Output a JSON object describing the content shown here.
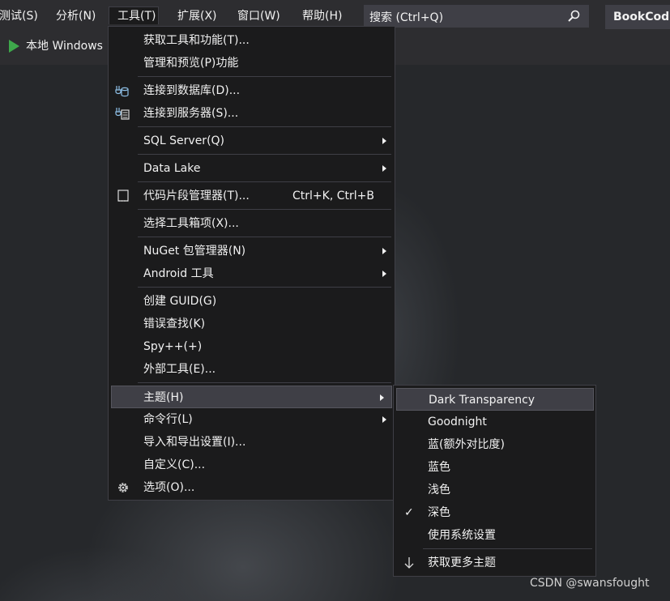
{
  "menubar": {
    "items": [
      {
        "label": "测试(S)"
      },
      {
        "label": "分析(N)"
      },
      {
        "label": "工具(T)"
      },
      {
        "label": "扩展(X)"
      },
      {
        "label": "窗口(W)"
      },
      {
        "label": "帮助(H)"
      }
    ],
    "search_placeholder": "搜索 (Ctrl+Q)",
    "solution_name": "BookCod"
  },
  "toolbar": {
    "run_label": "本地 Windows"
  },
  "tools_menu": {
    "items": [
      {
        "label": "获取工具和功能(T)..."
      },
      {
        "label": "管理和预览(P)功能"
      },
      {
        "label": "连接到数据库(D)...",
        "icon": "database-connect-icon"
      },
      {
        "label": "连接到服务器(S)...",
        "icon": "server-connect-icon"
      },
      {
        "label": "SQL Server(Q)"
      },
      {
        "label": "Data Lake"
      },
      {
        "label": "代码片段管理器(T)...",
        "shortcut": "Ctrl+K, Ctrl+B",
        "icon": "snippet-icon"
      },
      {
        "label": "选择工具箱项(X)..."
      },
      {
        "label": "NuGet 包管理器(N)"
      },
      {
        "label": "Android 工具"
      },
      {
        "label": "创建 GUID(G)"
      },
      {
        "label": "错误查找(K)"
      },
      {
        "label": "Spy++(+)"
      },
      {
        "label": "外部工具(E)..."
      },
      {
        "label": "主题(H)"
      },
      {
        "label": "命令行(L)"
      },
      {
        "label": "导入和导出设置(I)..."
      },
      {
        "label": "自定义(C)..."
      },
      {
        "label": "选项(O)...",
        "icon": "gear-icon"
      }
    ]
  },
  "theme_menu": {
    "items": [
      {
        "label": "Dark Transparency"
      },
      {
        "label": "Goodnight"
      },
      {
        "label": "蓝(额外对比度)"
      },
      {
        "label": "蓝色"
      },
      {
        "label": "浅色"
      },
      {
        "label": "深色",
        "checked": true
      },
      {
        "label": "使用系统设置"
      },
      {
        "label": "获取更多主题",
        "icon": "download-arrow-icon"
      }
    ],
    "check_mark": "✓"
  },
  "watermark": "CSDN @swansfought",
  "colors": {
    "menu_bg": "#1b1b1c",
    "menubar_bg": "#2d2d30",
    "highlight": "#3f3f46",
    "run_green": "#3ea84b"
  }
}
